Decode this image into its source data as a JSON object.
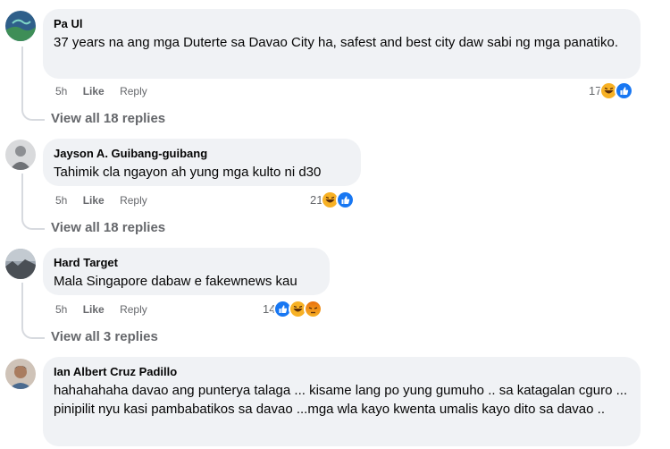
{
  "comments": [
    {
      "author": "Pa Ul",
      "text": "37 years na ang mga Duterte sa Davao City ha, safest and best city daw sabi ng mga panatiko.",
      "time": "5h",
      "like": "Like",
      "reply": "Reply",
      "reaction_count": "17",
      "reactions": [
        "haha-icon",
        "like-icon"
      ],
      "view_replies": "View all 18 replies"
    },
    {
      "author": "Jayson A. Guibang-guibang",
      "text": "Tahimik cla ngayon ah yung mga kulto ni d30",
      "time": "5h",
      "like": "Like",
      "reply": "Reply",
      "reaction_count": "21",
      "reactions": [
        "haha-icon",
        "like-icon"
      ],
      "view_replies": "View all 18 replies"
    },
    {
      "author": "Hard Target",
      "text": "Mala Singapore dabaw e fakewnews kau",
      "time": "5h",
      "like": "Like",
      "reply": "Reply",
      "reaction_count": "14",
      "reactions": [
        "like-icon",
        "haha-icon",
        "angry-icon"
      ],
      "view_replies": "View all 3 replies"
    },
    {
      "author": "Ian Albert Cruz Padillo",
      "text": "hahahahaha davao ang punterya talaga ... kisame lang po yung gumuho .. sa katagalan cguro ... pinipilit nyu kasi pambabatikos sa davao ...mga wla kayo kwenta umalis kayo dito sa davao .."
    }
  ],
  "colors": {
    "bubble": "#f0f2f5",
    "meta": "#65676b",
    "like_blue": "#1877f2",
    "haha_yellow": "#f7b125",
    "angry_orange": "#e9710f"
  }
}
